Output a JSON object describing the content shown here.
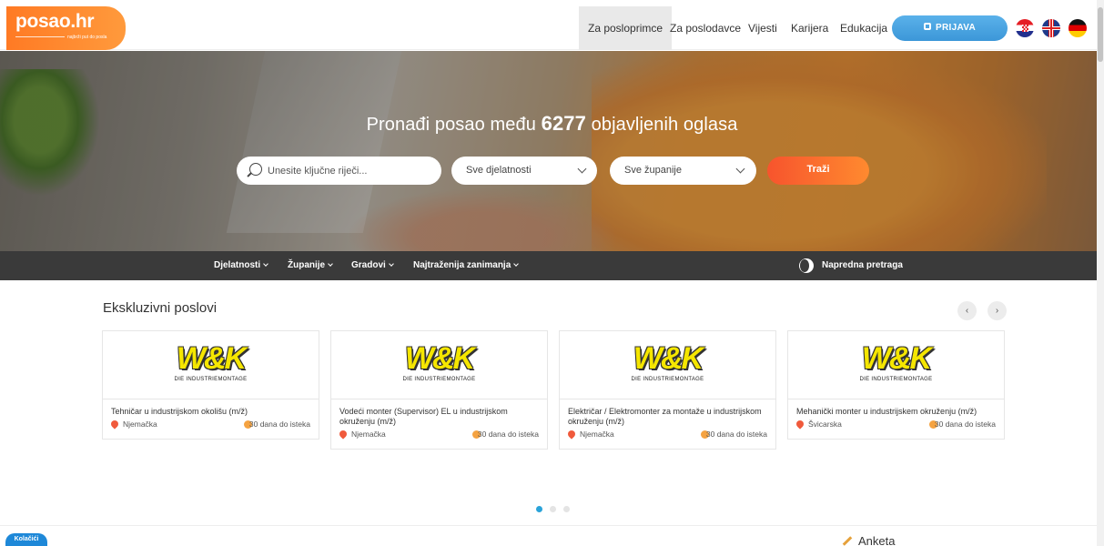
{
  "header": {
    "logo": "posao.hr",
    "logo_tagline": "najbrži put do posla",
    "nav": [
      "Za posloprimce",
      "Za poslodavce",
      "Vijesti",
      "Karijera",
      "Edukacija"
    ],
    "login_label": "PRIJAVA",
    "flags": [
      "croatia",
      "united-kingdom",
      "germany"
    ]
  },
  "hero": {
    "title_prefix": "Pronađi posao među",
    "job_count": "6277",
    "title_suffix": "objavljenih oglasa",
    "search_placeholder": "Unesite ključne riječi...",
    "industry_select": "Sve djelatnosti",
    "county_select": "Sve županije",
    "search_button": "Traži"
  },
  "subnav": {
    "items": [
      "Djelatnosti",
      "Županije",
      "Gradovi",
      "Najtraženija zanimanja"
    ],
    "advanced_search": "Napredna pretraga"
  },
  "exclusive": {
    "title": "Ekskluzivni poslovi",
    "prev": "‹",
    "next": "›",
    "cards": [
      {
        "logo_main": "W&K",
        "logo_sub": "DIE INDUSTRIEMONTAGE",
        "title": "Tehničar u industrijskom okolišu (m/ž)",
        "location": "Njemačka",
        "days": "30 dana do isteka"
      },
      {
        "logo_main": "W&K",
        "logo_sub": "DIE INDUSTRIEMONTAGE",
        "title": "Vodeći monter (Supervisor) EL u industrijskom okruženju (m/ž)",
        "location": "Njemačka",
        "days": "30 dana do isteka"
      },
      {
        "logo_main": "W&K",
        "logo_sub": "DIE INDUSTRIEMONTAGE",
        "title": "Električar / Elektromonter za montaže u industrijskom okruženju (m/ž)",
        "location": "Njemačka",
        "days": "30 dana do isteka"
      },
      {
        "logo_main": "W&K",
        "logo_sub": "DIE INDUSTRIEMONTAGE",
        "title": "Mehanički monter u industrijskem okruženju (m/ž)",
        "location": "Švicarska",
        "days": "30 dana do isteka"
      }
    ]
  },
  "footer": {
    "cookies": "Kolačići",
    "survey": "Anketa"
  },
  "colors": {
    "brand_orange": "#ff7a24",
    "login_blue": "#3c97d8",
    "dark_nav": "#3a3a3a",
    "dot_active": "#2aa3d9"
  }
}
